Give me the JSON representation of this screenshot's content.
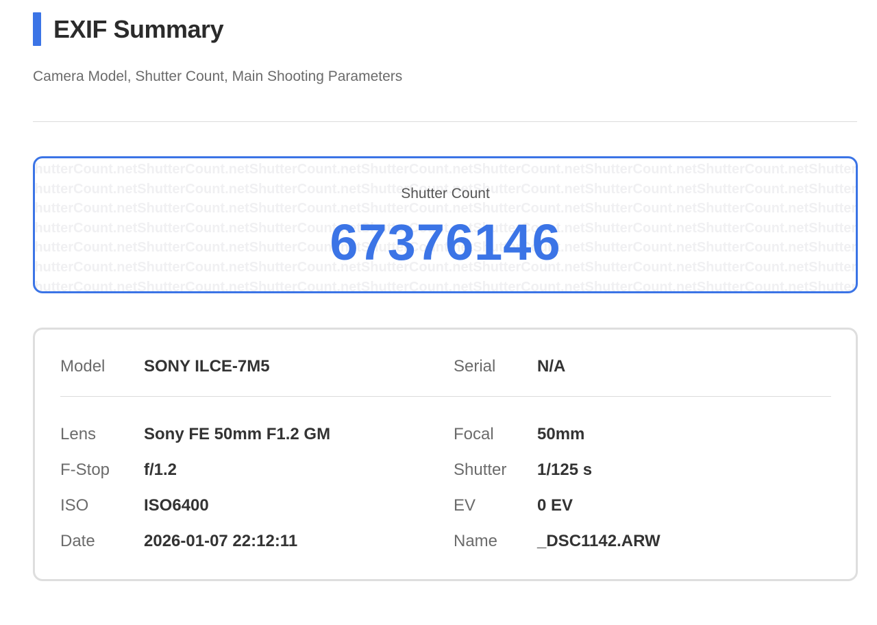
{
  "header": {
    "title": "EXIF Summary",
    "subtitle": "Camera Model, Shutter Count, Main Shooting Parameters",
    "accent_color": "#3b74e6"
  },
  "shutter": {
    "label": "Shutter Count",
    "value": "67376146",
    "watermark_text": "ShutterCount.net"
  },
  "info": {
    "model_label": "Model",
    "model_value": "SONY ILCE-7M5",
    "serial_label": "Serial",
    "serial_value": "N/A",
    "lens_label": "Lens",
    "lens_value": "Sony FE 50mm F1.2 GM",
    "focal_label": "Focal",
    "focal_value": "50mm",
    "fstop_label": "F-Stop",
    "fstop_value": "f/1.2",
    "shutter_label": "Shutter",
    "shutter_value": "1/125 s",
    "iso_label": "ISO",
    "iso_value": "ISO6400",
    "ev_label": "EV",
    "ev_value": "0 EV",
    "date_label": "Date",
    "date_value": "2026-01-07 22:12:11",
    "name_label": "Name",
    "name_value": "_DSC1142.ARW"
  }
}
